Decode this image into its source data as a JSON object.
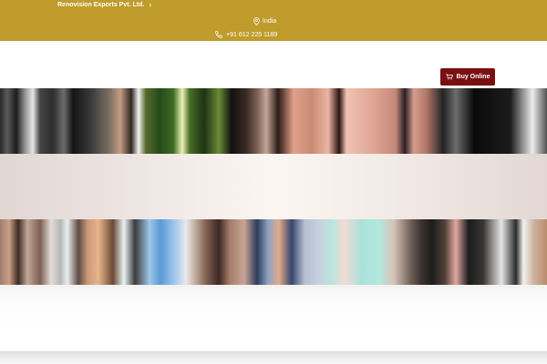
{
  "topbar": {
    "company_name": "Renovision Exports Pvt. Ltd.",
    "company_chevron_icon": "chevron-right-icon",
    "location_icon": "map-pin-icon",
    "location": "India",
    "phone_icon": "phone-icon",
    "phone": "+91 612 225 1189",
    "background_color": "#bf9c2c"
  },
  "header": {
    "buy_online_label": "Buy Online",
    "buy_online_icon": "cart-icon",
    "buy_online_color": "#7a0f12"
  },
  "hero": {
    "banner_count": 3
  }
}
